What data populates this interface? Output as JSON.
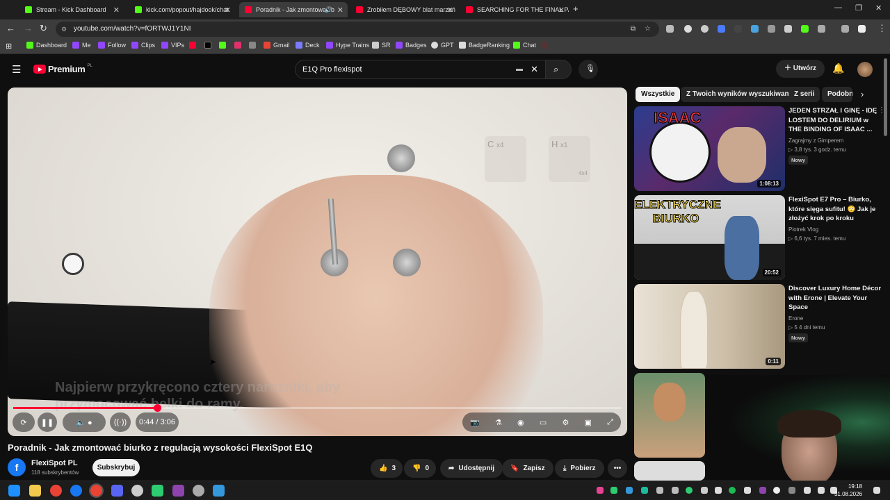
{
  "browser": {
    "tabs": [
      {
        "title": "Stream - Kick Dashboard",
        "color": "#53fc18",
        "active": false
      },
      {
        "title": "kick.com/popout/hajdook/chat",
        "color": "#53fc18",
        "active": false
      },
      {
        "title": "Poradnik - Jak zmontować b",
        "color": "#ff0033",
        "active": true
      },
      {
        "title": "Zrobiłem DĘBOWY blat marzeń",
        "color": "#ff0033",
        "active": false
      },
      {
        "title": "SEARCHING FOR THE FINAL PA",
        "color": "#ff0033",
        "active": false
      }
    ],
    "new_tab": "+",
    "url": "youtube.com/watch?v=fORTWJ1Y1NI",
    "bookmarks": [
      {
        "label": "Dashboard",
        "color": "#53fc18"
      },
      {
        "label": "Me",
        "color": "#9146ff"
      },
      {
        "label": "Follow",
        "color": "#9146ff"
      },
      {
        "label": "Clips",
        "color": "#9146ff"
      },
      {
        "label": "VIPs",
        "color": "#9146ff"
      },
      {
        "label": "",
        "color": "#ff0033"
      },
      {
        "label": "",
        "color": "#000000"
      },
      {
        "label": "",
        "color": "#53fc18"
      },
      {
        "label": "",
        "color": "#e1306c"
      },
      {
        "label": "",
        "color": "#888888"
      },
      {
        "label": "Gmail",
        "color": "#ea4335"
      },
      {
        "label": "Deck",
        "color": "#7b7bff"
      },
      {
        "label": "Hype Trains",
        "color": "#9146ff"
      },
      {
        "label": "SR",
        "color": "#cccccc"
      },
      {
        "label": "Badges",
        "color": "#9146ff"
      },
      {
        "label": "GPT",
        "color": "#dddddd"
      },
      {
        "label": "BadgeRanking",
        "color": "#dddddd"
      },
      {
        "label": "Chat",
        "color": "#53fc18"
      }
    ]
  },
  "youtube": {
    "logo_text": "Premium",
    "logo_sup": "PL",
    "search_query": "E1Q Pro flexispot",
    "create_label": "Utwórz",
    "player": {
      "subtitle_line1": "Najpierw przykręcono cztery narożniki, aby",
      "subtitle_line2": "przymocować belki do ramy.",
      "time": "0:44 / 3:06",
      "progress_fraction": 0.237,
      "hint_c": "C",
      "hint_c_count": "x4",
      "hint_h": "H",
      "hint_h_count": "x1",
      "hint_h_size": "4x4"
    },
    "video_title": "Poradnik - Jak zmontować biurko z regulacją wysokości FlexiSpot E1Q",
    "channel": {
      "name": "FlexiSpot PL",
      "subs": "118 subskrybentów",
      "avatar_letter": "f"
    },
    "subscribe_label": "Subskrybuj",
    "actions": {
      "likes": "3",
      "dislikes": "0",
      "share": "Udostępnij",
      "save": "Zapisz",
      "download": "Pobierz"
    },
    "chips": [
      "Wszystkie",
      "Z Twoich wyników wyszukiwania",
      "Z serii",
      "Podobne"
    ],
    "recommendations": [
      {
        "title": "JEDEN STRZAŁ I GINĘ - IDĘ LOSTEM DO DELIRIUM w THE BINDING OF ISAAC ...",
        "channel": "Zagrajmy z Gimperem",
        "meta": "▷ 3,8 tys.  3 godz. temu",
        "badge": "Nowy",
        "duration": "1:08:13",
        "thumb_text": "ISAAC"
      },
      {
        "title": "FlexiSpot E7 Pro – Biurko, które sięga sufitu! 😳 Jak je złożyć krok po kroku",
        "channel": "Piotrek Vlog",
        "meta": "▷ 6,6 tys.  7 mies. temu",
        "badge": "",
        "duration": "20:52",
        "thumb_text": "ELEKTRYCZNE BIURKO"
      },
      {
        "title": "Discover Luxury Home Décor with Erone | Elevate Your Space",
        "channel": "Erone",
        "meta": "▷ 5  4 dni temu",
        "badge": "Nowy",
        "duration": "0:11",
        "thumb_text": ""
      }
    ]
  },
  "taskbar": {
    "time": "19:18",
    "date": "31.08.2026"
  }
}
